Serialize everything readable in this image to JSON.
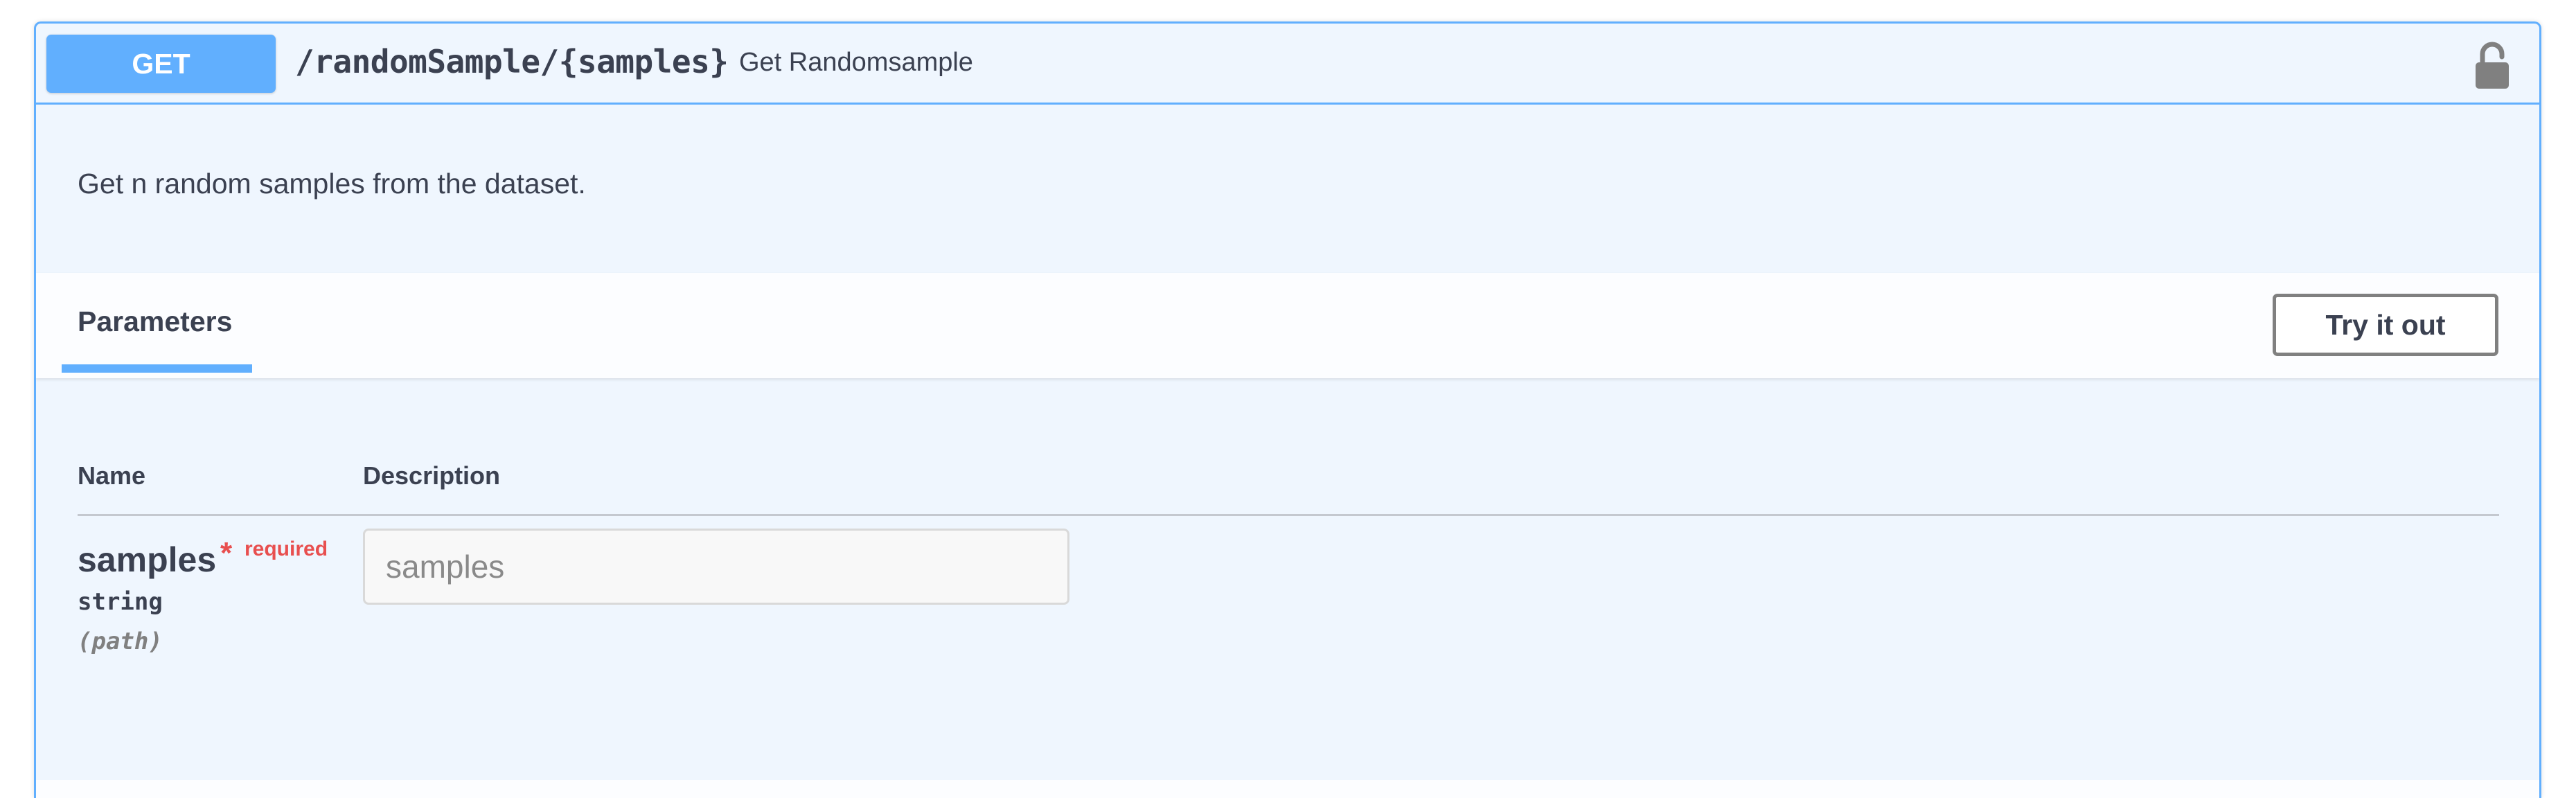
{
  "endpoint": {
    "method": "GET",
    "path": "/randomSample/{samples}",
    "summary": "Get Randomsample",
    "description": "Get n random samples from the dataset."
  },
  "parameters_section": {
    "tab_label": "Parameters",
    "try_button_label": "Try it out",
    "columns": {
      "name": "Name",
      "description": "Description"
    },
    "items": [
      {
        "name": "samples",
        "required_marker": "*",
        "required_label": "required",
        "type": "string",
        "location": "(path)",
        "input_placeholder": "samples",
        "input_value": ""
      }
    ]
  },
  "icons": {
    "lock": "lock-icon"
  },
  "colors": {
    "get_accent": "#61affe",
    "block_background": "#eff6fe",
    "text": "#3b4151",
    "required": "#e84f4f"
  }
}
